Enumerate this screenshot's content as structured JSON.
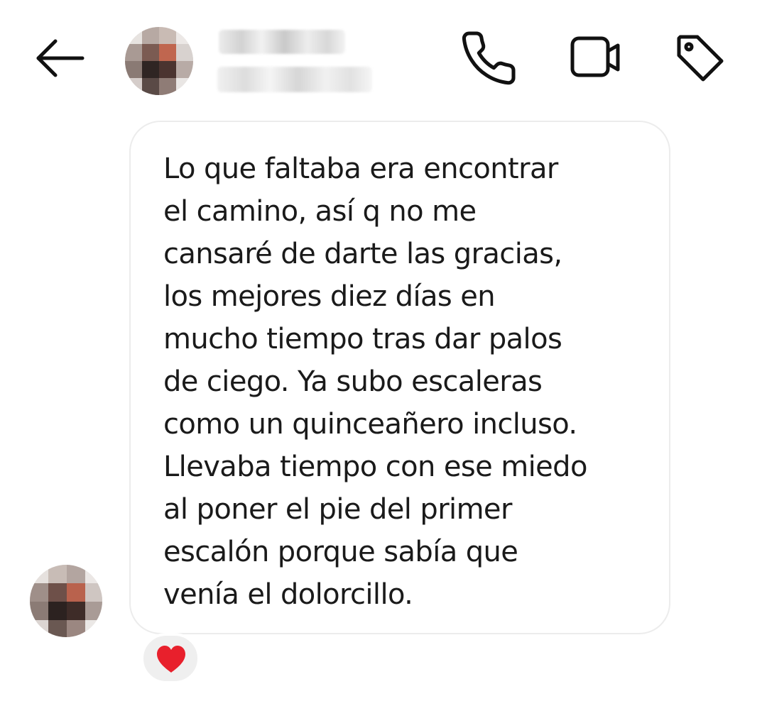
{
  "header": {
    "icons": {
      "back": "arrow-left-icon",
      "call": "phone-icon",
      "video": "video-camera-icon",
      "tag": "tag-icon"
    }
  },
  "message": {
    "text": "Lo que faltaba era encontrar\nel camino, así q no me\ncansaré de darte las gracias,\nlos mejores diez días en\nmucho tiempo tras dar palos\nde ciego. Ya subo escaleras\ncomo un quinceañero incluso.\nLlevaba tiempo con ese miedo\nal poner el pie del primer\nescalón porque sabía que\nvenía el dolorcillo.",
    "reaction": "heart-icon",
    "reaction_color": "#e8202c"
  },
  "colors": {
    "background": "#ffffff",
    "bubble_border": "#ececec",
    "text": "#1a1a1a",
    "reaction_bg": "#efefef"
  }
}
